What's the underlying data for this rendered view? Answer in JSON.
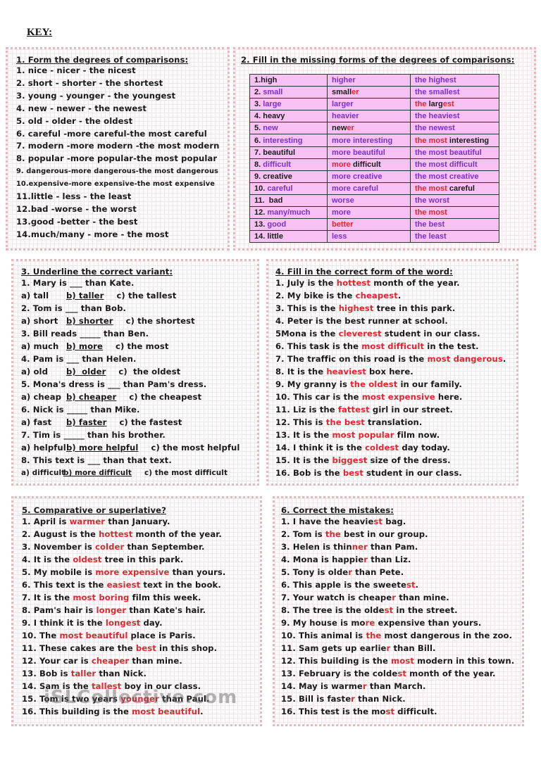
{
  "key_title": "KEY:",
  "colors": {
    "answer_red": "#e0262f",
    "table_bg": "#f7c2f3",
    "table_purple": "#7a2fd0",
    "box_border": "#e8b8bc"
  },
  "exercise1": {
    "title": "1. Form the degrees of comparisons:",
    "lines": [
      "1. nice - nicer - the nicest",
      "2. short - shorter - the shortest",
      "3. young - younger - the youngest",
      "4. new - newer - the newest",
      "5. old - older - the oldest",
      "6. careful -more careful-the most careful",
      "7. modern -more modern -the most modern",
      "8. popular -more popular-the most popular",
      "9. dangerous-more dangerous-the most dangerous",
      "10.expensive-more expensive-the most expensive",
      "11.little - less - the least",
      "12.bad -worse - the worst",
      "13.good -better - the best",
      "14.much/many - more - the most"
    ]
  },
  "exercise2": {
    "title": "2. Fill in the missing forms of the degrees of comparisons:",
    "rows": [
      [
        [
          [
            "1.high",
            "blk"
          ]
        ],
        [
          [
            "higher",
            "pur"
          ]
        ],
        [
          [
            "the highest",
            "pur"
          ]
        ]
      ],
      [
        [
          [
            "2. ",
            "blk"
          ],
          [
            "small",
            "pur"
          ]
        ],
        [
          [
            "small",
            "blk"
          ],
          [
            "er",
            "rd"
          ]
        ],
        [
          [
            "the smallest",
            "pur"
          ]
        ]
      ],
      [
        [
          [
            "3. ",
            "blk"
          ],
          [
            "large",
            "pur"
          ]
        ],
        [
          [
            "larger",
            "pur"
          ]
        ],
        [
          [
            "the ",
            "rd"
          ],
          [
            "larg",
            "blk"
          ],
          [
            "est",
            "rd"
          ]
        ]
      ],
      [
        [
          [
            "4. heavy",
            "blk"
          ]
        ],
        [
          [
            "heavier",
            "pur"
          ]
        ],
        [
          [
            "the heaviest",
            "pur"
          ]
        ]
      ],
      [
        [
          [
            "5. ",
            "blk"
          ],
          [
            "new",
            "pur"
          ]
        ],
        [
          [
            "new",
            "blk"
          ],
          [
            "er",
            "rd"
          ]
        ],
        [
          [
            "the newest",
            "pur"
          ]
        ]
      ],
      [
        [
          [
            "6. ",
            "blk"
          ],
          [
            "interesting",
            "pur"
          ]
        ],
        [
          [
            "more interesting",
            "pur"
          ]
        ],
        [
          [
            "the most ",
            "rd"
          ],
          [
            "interesting",
            "blk"
          ]
        ]
      ],
      [
        [
          [
            "7. beautiful",
            "blk"
          ]
        ],
        [
          [
            "more beautiful",
            "pur"
          ]
        ],
        [
          [
            "the most beautiful",
            "pur"
          ]
        ]
      ],
      [
        [
          [
            "8. ",
            "blk"
          ],
          [
            "difficult",
            "pur"
          ]
        ],
        [
          [
            "more ",
            "rd"
          ],
          [
            "difficult",
            "blk"
          ]
        ],
        [
          [
            "the most difficult",
            "pur"
          ]
        ]
      ],
      [
        [
          [
            "9. creative",
            "blk"
          ]
        ],
        [
          [
            "more creative",
            "pur"
          ]
        ],
        [
          [
            "the most creative",
            "pur"
          ]
        ]
      ],
      [
        [
          [
            "10. ",
            "blk"
          ],
          [
            "careful",
            "pur"
          ]
        ],
        [
          [
            "more careful",
            "pur"
          ]
        ],
        [
          [
            "the most ",
            "rd"
          ],
          [
            "careful",
            "blk"
          ]
        ]
      ],
      [
        [
          [
            "11.  bad",
            "blk"
          ]
        ],
        [
          [
            "worse",
            "pur"
          ]
        ],
        [
          [
            "the worst",
            "pur"
          ]
        ]
      ],
      [
        [
          [
            "12. ",
            "blk"
          ],
          [
            "many/much",
            "pur"
          ]
        ],
        [
          [
            "more",
            "pur"
          ]
        ],
        [
          [
            "the most",
            "rd"
          ]
        ]
      ],
      [
        [
          [
            "13. ",
            "blk"
          ],
          [
            "good",
            "pur"
          ]
        ],
        [
          [
            "better",
            "rd"
          ]
        ],
        [
          [
            "the best",
            "pur"
          ]
        ]
      ],
      [
        [
          [
            "14. little",
            "blk"
          ]
        ],
        [
          [
            "less",
            "pur"
          ]
        ],
        [
          [
            "the least",
            "pur"
          ]
        ]
      ]
    ]
  },
  "exercise3": {
    "title": "3. Underline the correct variant:",
    "items": [
      {
        "q": "1. Mary is ___ than Kate.",
        "a": "a) tall",
        "b": "b) taller",
        "c": "c) the tallest"
      },
      {
        "q": "2. Tom is ___ than Bob.",
        "a": "a) short",
        "b": "b) shorter",
        "c": "c) the shortest"
      },
      {
        "q": "3. Bill reads _____ than Ben.",
        "a": "a) much",
        "b": "b) more",
        "c": "c) the most"
      },
      {
        "q": "4. Pam is ___ than Helen.",
        "a": "a) old",
        "b": "b)  older",
        "c": "c)  the oldest"
      },
      {
        "q": "5. Mona's dress is ___ than Pam's dress.",
        "a": "a) cheap",
        "b": "b) cheaper",
        "c": "c) the cheapest"
      },
      {
        "q": "6. Nick is _____ than Mike.",
        "a": "a) fast",
        "b": "b) faster",
        "c": "c) the fastest"
      },
      {
        "q": "7. Tim is _____ than his brother.",
        "a": "a) helpful",
        "b": "b) more helpful",
        "c": "c) the most helpful"
      },
      {
        "q": "8. This text is ___ than that text.",
        "a": "a) difficult",
        "b": "b) more difficult",
        "c": "c) the most difficult"
      }
    ]
  },
  "exercise4": {
    "title": "4. Fill in the correct form of the word:",
    "lines": [
      [
        [
          "1. July is the ",
          ""
        ],
        [
          "hottest",
          "r"
        ],
        [
          " month of the year.",
          ""
        ]
      ],
      [
        [
          "2. My bike is the ",
          ""
        ],
        [
          "cheapest",
          "r"
        ],
        [
          ".",
          ""
        ]
      ],
      [
        [
          "3. This is the ",
          ""
        ],
        [
          "highest",
          "r"
        ],
        [
          " tree in this park.",
          ""
        ]
      ],
      [
        [
          "4. Peter is the best runner at school.",
          ""
        ]
      ],
      [
        [
          "5Mona is the ",
          ""
        ],
        [
          "cleverest",
          "r"
        ],
        [
          " student in our class.",
          ""
        ]
      ],
      [
        [
          "6. This task is the ",
          ""
        ],
        [
          "most difficult",
          "r"
        ],
        [
          " in the test.",
          ""
        ]
      ],
      [
        [
          "7. The traffic on this road is the ",
          ""
        ],
        [
          "most dangerous",
          "r"
        ],
        [
          ".",
          ""
        ]
      ],
      [
        [
          "8. It is the ",
          ""
        ],
        [
          "heaviest",
          "r"
        ],
        [
          " box here.",
          ""
        ]
      ],
      [
        [
          "9. My granny is ",
          ""
        ],
        [
          "the oldest",
          "r"
        ],
        [
          " in our family.",
          ""
        ]
      ],
      [
        [
          "10. This car is the ",
          ""
        ],
        [
          "most expensive",
          "r"
        ],
        [
          " here.",
          ""
        ]
      ],
      [
        [
          "11. Liz is the ",
          ""
        ],
        [
          "fattest",
          "r"
        ],
        [
          " girl in our street.",
          ""
        ]
      ],
      [
        [
          "12. This is ",
          ""
        ],
        [
          "the best",
          "r"
        ],
        [
          " translation.",
          ""
        ]
      ],
      [
        [
          "13. It is the ",
          ""
        ],
        [
          "most popular",
          "r"
        ],
        [
          " film now.",
          ""
        ]
      ],
      [
        [
          "14. I think it is the ",
          ""
        ],
        [
          "coldest",
          "r"
        ],
        [
          " day today.",
          ""
        ]
      ],
      [
        [
          "15. It is the ",
          ""
        ],
        [
          "biggest",
          "r"
        ],
        [
          " size of the dress.",
          ""
        ]
      ],
      [
        [
          "16. Bob is the ",
          ""
        ],
        [
          "best",
          "r"
        ],
        [
          " student in our class.",
          ""
        ]
      ]
    ]
  },
  "exercise5": {
    "title": "5. Comparative or superlative?",
    "lines": [
      [
        [
          "1. April is ",
          ""
        ],
        [
          "warmer",
          "r"
        ],
        [
          " than January.",
          ""
        ]
      ],
      [
        [
          "2. August is the ",
          ""
        ],
        [
          "hottest",
          "r"
        ],
        [
          " month of the year.",
          ""
        ]
      ],
      [
        [
          "3. November is ",
          ""
        ],
        [
          "colder",
          "r"
        ],
        [
          " than September.",
          ""
        ]
      ],
      [
        [
          "4. It is the ",
          ""
        ],
        [
          "oldest",
          "r"
        ],
        [
          " tree in this park.",
          ""
        ]
      ],
      [
        [
          "5. My mobile is ",
          ""
        ],
        [
          "more expensive",
          "r"
        ],
        [
          " than yours.",
          ""
        ]
      ],
      [
        [
          "6. This text is the ",
          ""
        ],
        [
          "easiest",
          "r"
        ],
        [
          " text in the book.",
          ""
        ]
      ],
      [
        [
          "7. It is the ",
          ""
        ],
        [
          "most boring",
          "r"
        ],
        [
          " film this week.",
          ""
        ]
      ],
      [
        [
          "8. Pam's hair is ",
          ""
        ],
        [
          "longer",
          "r"
        ],
        [
          " than Kate's hair.",
          ""
        ]
      ],
      [
        [
          "9. I think it is the ",
          ""
        ],
        [
          "longest",
          "r"
        ],
        [
          " day.",
          ""
        ]
      ],
      [
        [
          "10. The ",
          ""
        ],
        [
          "most beautiful",
          "r"
        ],
        [
          " place is Paris.",
          ""
        ]
      ],
      [
        [
          "11. These cakes are the ",
          ""
        ],
        [
          "best",
          "r"
        ],
        [
          " in this shop.",
          ""
        ]
      ],
      [
        [
          "12. Your car is ",
          ""
        ],
        [
          "cheaper",
          "r"
        ],
        [
          " than mine.",
          ""
        ]
      ],
      [
        [
          "13. Bob is ",
          ""
        ],
        [
          "taller",
          "r"
        ],
        [
          " than Nick.",
          ""
        ]
      ],
      [
        [
          "14. Sam is the ",
          ""
        ],
        [
          "tallest",
          "r"
        ],
        [
          " boy in our class.",
          ""
        ]
      ],
      [
        [
          "15. Tom is two years ",
          ""
        ],
        [
          "younger",
          "r"
        ],
        [
          " than Paul.",
          ""
        ]
      ],
      [
        [
          "16. This building is the ",
          ""
        ],
        [
          "most beautiful",
          "r"
        ],
        [
          ".",
          ""
        ]
      ]
    ]
  },
  "exercise6": {
    "title": "6. Correct the mistakes:",
    "lines": [
      [
        [
          "1. I have the heavie",
          ""
        ],
        [
          "st",
          "r"
        ],
        [
          " bag.",
          ""
        ]
      ],
      [
        [
          "2. Tom is ",
          ""
        ],
        [
          "the",
          "r"
        ],
        [
          " best in our group.",
          ""
        ]
      ],
      [
        [
          "3. Helen is thin",
          ""
        ],
        [
          "ner",
          "r"
        ],
        [
          " than Pam.",
          ""
        ]
      ],
      [
        [
          "4. Mona is happie",
          ""
        ],
        [
          "r",
          "r"
        ],
        [
          " than Liz.",
          ""
        ]
      ],
      [
        [
          "5. Tony is olde",
          ""
        ],
        [
          "r",
          "r"
        ],
        [
          " than Pete.",
          ""
        ]
      ],
      [
        [
          "6. This apple is the sweete",
          ""
        ],
        [
          "st",
          "r"
        ],
        [
          ".",
          ""
        ]
      ],
      [
        [
          "7. Your watch is cheape",
          ""
        ],
        [
          "r",
          "r"
        ],
        [
          " than mine.",
          ""
        ]
      ],
      [
        [
          "8. The tree is the olde",
          ""
        ],
        [
          "st",
          "r"
        ],
        [
          " in the street.",
          ""
        ]
      ],
      [
        [
          "9. My house is mo",
          ""
        ],
        [
          "re",
          "r"
        ],
        [
          " expensive than yours.",
          ""
        ]
      ],
      [
        [
          "10. This animal is ",
          ""
        ],
        [
          "the",
          "r"
        ],
        [
          " most dangerous in the zoo.",
          ""
        ]
      ],
      [
        [
          "11. Sam gets up earlie",
          ""
        ],
        [
          "r",
          "r"
        ],
        [
          " than Bill.",
          ""
        ]
      ],
      [
        [
          "12. This building is the ",
          ""
        ],
        [
          "most",
          "r"
        ],
        [
          " modern in this town.",
          ""
        ]
      ],
      [
        [
          "13. February is the colde",
          ""
        ],
        [
          "st",
          "r"
        ],
        [
          " month of the year.",
          ""
        ]
      ],
      [
        [
          "14. May is warme",
          ""
        ],
        [
          "r",
          "r"
        ],
        [
          " than March.",
          ""
        ]
      ],
      [
        [
          "15. Bill is faste",
          ""
        ],
        [
          "r",
          "r"
        ],
        [
          " than Nick.",
          ""
        ]
      ],
      [
        [
          "16. This test is the mo",
          ""
        ],
        [
          "st",
          "r"
        ],
        [
          " difficult.",
          ""
        ]
      ]
    ]
  },
  "watermark": "iSLCollective.com"
}
